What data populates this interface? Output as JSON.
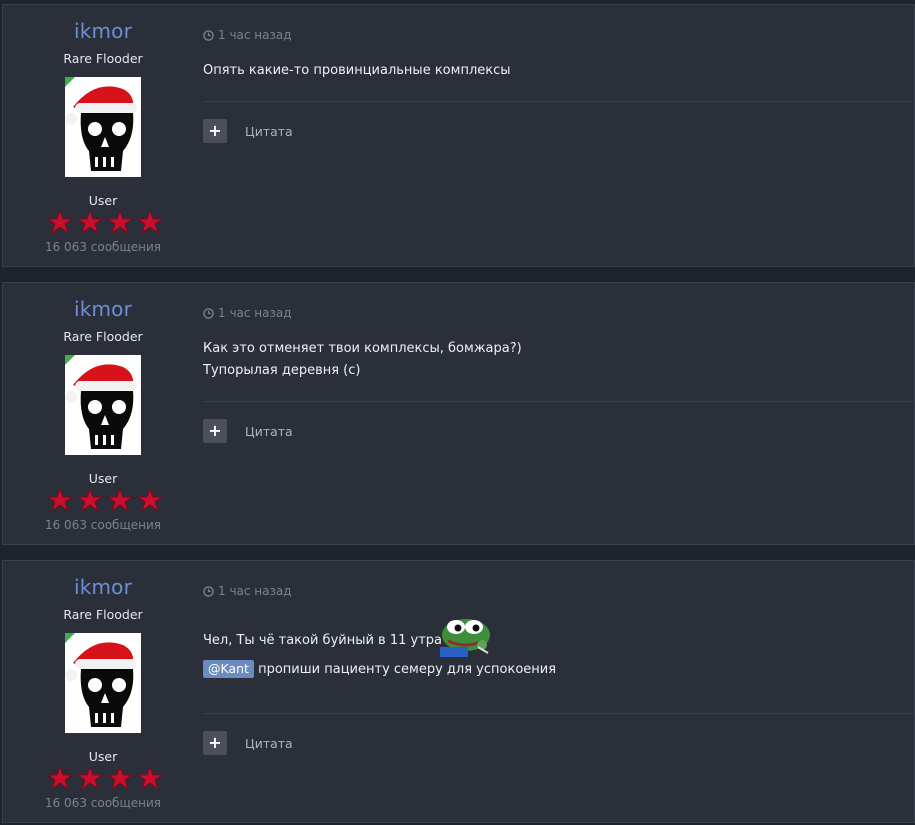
{
  "posts": [
    {
      "author": "ikmor",
      "rank_title": "Rare Flooder",
      "group": "User",
      "post_count": "16 063 сообщения",
      "time": "1 час назад",
      "lines": [
        "Опять какие-то провинциальные комплексы"
      ],
      "quote_label": "Цитата"
    },
    {
      "author": "ikmor",
      "rank_title": "Rare Flooder",
      "group": "User",
      "post_count": "16 063 сообщения",
      "time": "1 час назад",
      "lines": [
        "Как это отменяет твои комплексы, бомжара?)",
        "Тупорылая деревня (с)"
      ],
      "quote_label": "Цитата"
    },
    {
      "author": "ikmor",
      "rank_title": "Rare Flooder",
      "group": "User",
      "post_count": "16 063 сообщения",
      "time": "1 час назад",
      "line1": "Чел, Ты чё такой буйный в 11 утра",
      "mention": "@Kant",
      "line2": " пропиши пациенту семеру для успокоения",
      "quote_label": "Цитата"
    }
  ],
  "colors": {
    "page_bg": "#1f232b",
    "post_bg": "#2b2f39",
    "username": "#6d8fd6",
    "mention_bg": "#6a8cc0",
    "star_red": "#c8102e"
  },
  "icons": {
    "time": "clock-icon",
    "quote_button": "plus-icon",
    "rank_badges": "red-star-icon",
    "reaction": "pepe-emoji"
  }
}
